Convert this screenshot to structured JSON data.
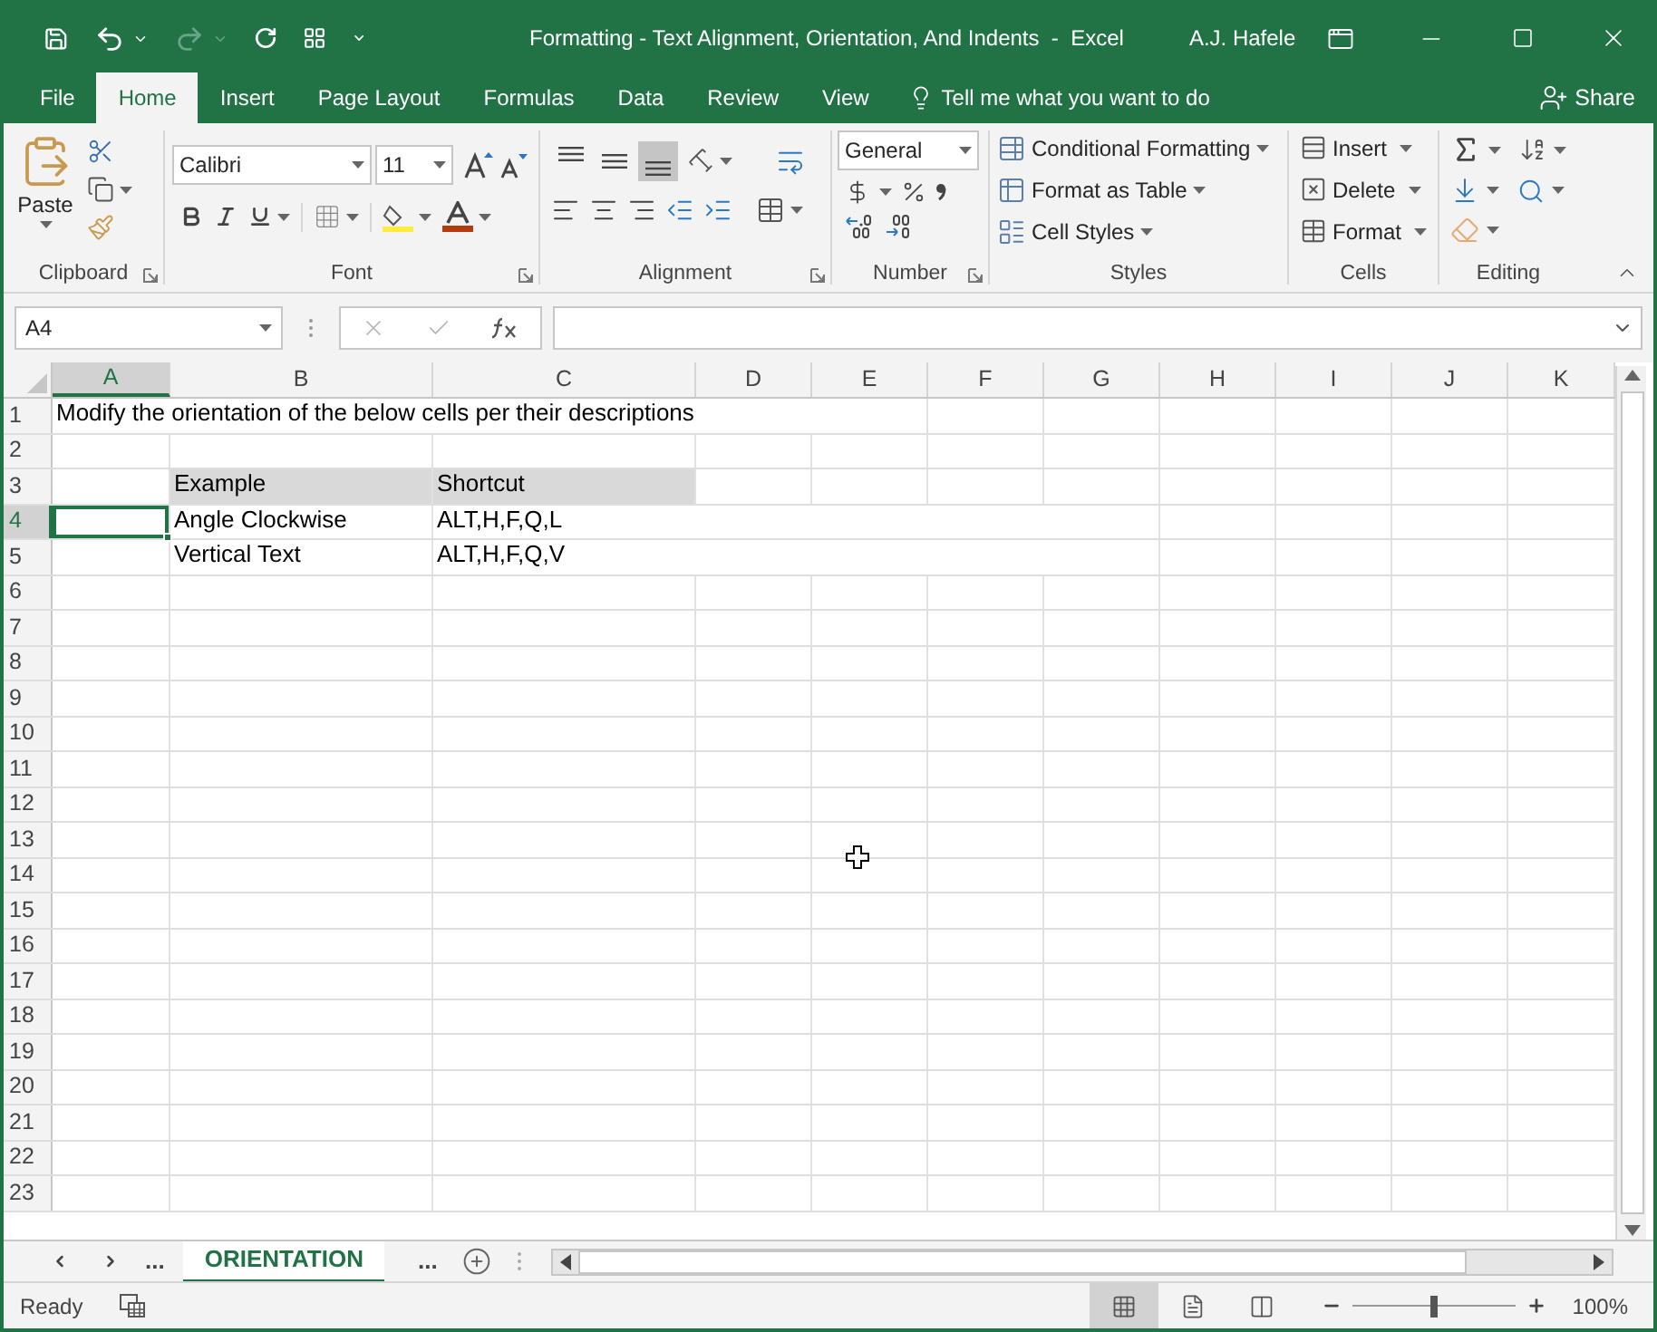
{
  "title_bar": {
    "title": "Formatting - Text Alignment, Orientation, And Indents  -  Excel",
    "user": "A.J. Hafele"
  },
  "ribbon_tabs": [
    {
      "label": "File",
      "selected": false
    },
    {
      "label": "Home",
      "selected": true
    },
    {
      "label": "Insert",
      "selected": false
    },
    {
      "label": "Page Layout",
      "selected": false
    },
    {
      "label": "Formulas",
      "selected": false
    },
    {
      "label": "Data",
      "selected": false
    },
    {
      "label": "Review",
      "selected": false
    },
    {
      "label": "View",
      "selected": false
    }
  ],
  "tell_me": "Tell me what you want to do",
  "share": "Share",
  "clipboard": {
    "paste": "Paste",
    "label": "Clipboard"
  },
  "font": {
    "name": "Calibri",
    "size": "11",
    "label": "Font"
  },
  "alignment": {
    "label": "Alignment",
    "vertical": [
      {
        "kind": "top",
        "selected": false
      },
      {
        "kind": "middle",
        "selected": false
      },
      {
        "kind": "bottom",
        "selected": true
      }
    ]
  },
  "number": {
    "format": "General",
    "label": "Number"
  },
  "styles": {
    "label": "Styles",
    "buttons": [
      "Conditional Formatting",
      "Format as Table",
      "Cell Styles"
    ]
  },
  "cells": {
    "label": "Cells",
    "buttons": [
      "Insert",
      "Delete",
      "Format"
    ]
  },
  "editing": {
    "label": "Editing"
  },
  "name_box": "A4",
  "columns": [
    {
      "label": "A",
      "selected": true
    },
    {
      "label": "B",
      "selected": false
    },
    {
      "label": "C",
      "selected": false
    },
    {
      "label": "D",
      "selected": false
    },
    {
      "label": "E",
      "selected": false
    },
    {
      "label": "F",
      "selected": false
    },
    {
      "label": "G",
      "selected": false
    },
    {
      "label": "H",
      "selected": false
    },
    {
      "label": "I",
      "selected": false
    },
    {
      "label": "J",
      "selected": false
    },
    {
      "label": "K",
      "selected": false
    }
  ],
  "rows": [
    {
      "label": "1",
      "selected": false,
      "A": {
        "text": "Modify the orientation of the below cells per their descriptions",
        "shaded": false,
        "selected": false
      }
    },
    {
      "label": "2",
      "selected": false
    },
    {
      "label": "3",
      "selected": false,
      "B": {
        "text": "Example",
        "shaded": true,
        "selected": false
      },
      "C": {
        "text": "Shortcut",
        "shaded": true,
        "selected": false
      }
    },
    {
      "label": "4",
      "selected": true,
      "A": {
        "shaded": false,
        "selected": true
      },
      "B": {
        "text": "Angle Clockwise",
        "shaded": false,
        "selected": false
      },
      "C": {
        "text": "ALT,H,F,Q,L",
        "shaded": false,
        "selected": false
      }
    },
    {
      "label": "5",
      "selected": false,
      "B": {
        "text": "Vertical Text",
        "shaded": false,
        "selected": false
      },
      "C": {
        "text": "ALT,H,F,Q,V",
        "shaded": false,
        "selected": false
      }
    },
    {
      "label": "6",
      "selected": false
    },
    {
      "label": "7",
      "selected": false
    },
    {
      "label": "8",
      "selected": false
    },
    {
      "label": "9",
      "selected": false
    },
    {
      "label": "10",
      "selected": false
    },
    {
      "label": "11",
      "selected": false
    },
    {
      "label": "12",
      "selected": false
    },
    {
      "label": "13",
      "selected": false
    },
    {
      "label": "14",
      "selected": false
    },
    {
      "label": "15",
      "selected": false
    },
    {
      "label": "16",
      "selected": false
    },
    {
      "label": "17",
      "selected": false
    },
    {
      "label": "18",
      "selected": false
    },
    {
      "label": "19",
      "selected": false
    },
    {
      "label": "20",
      "selected": false
    },
    {
      "label": "21",
      "selected": false
    },
    {
      "label": "22",
      "selected": false
    },
    {
      "label": "23",
      "selected": false
    }
  ],
  "sheet_tabs": {
    "before": "...",
    "tabs": [
      {
        "label": "ORIENTATION",
        "selected": true
      }
    ],
    "after": "..."
  },
  "status_bar": {
    "text": "Ready",
    "views": [
      {
        "kind": "normal",
        "selected": true
      },
      {
        "kind": "page_layout",
        "selected": false
      },
      {
        "kind": "page_break",
        "selected": false
      }
    ],
    "zoom": {
      "level": 0.5,
      "reading": "100%"
    }
  }
}
